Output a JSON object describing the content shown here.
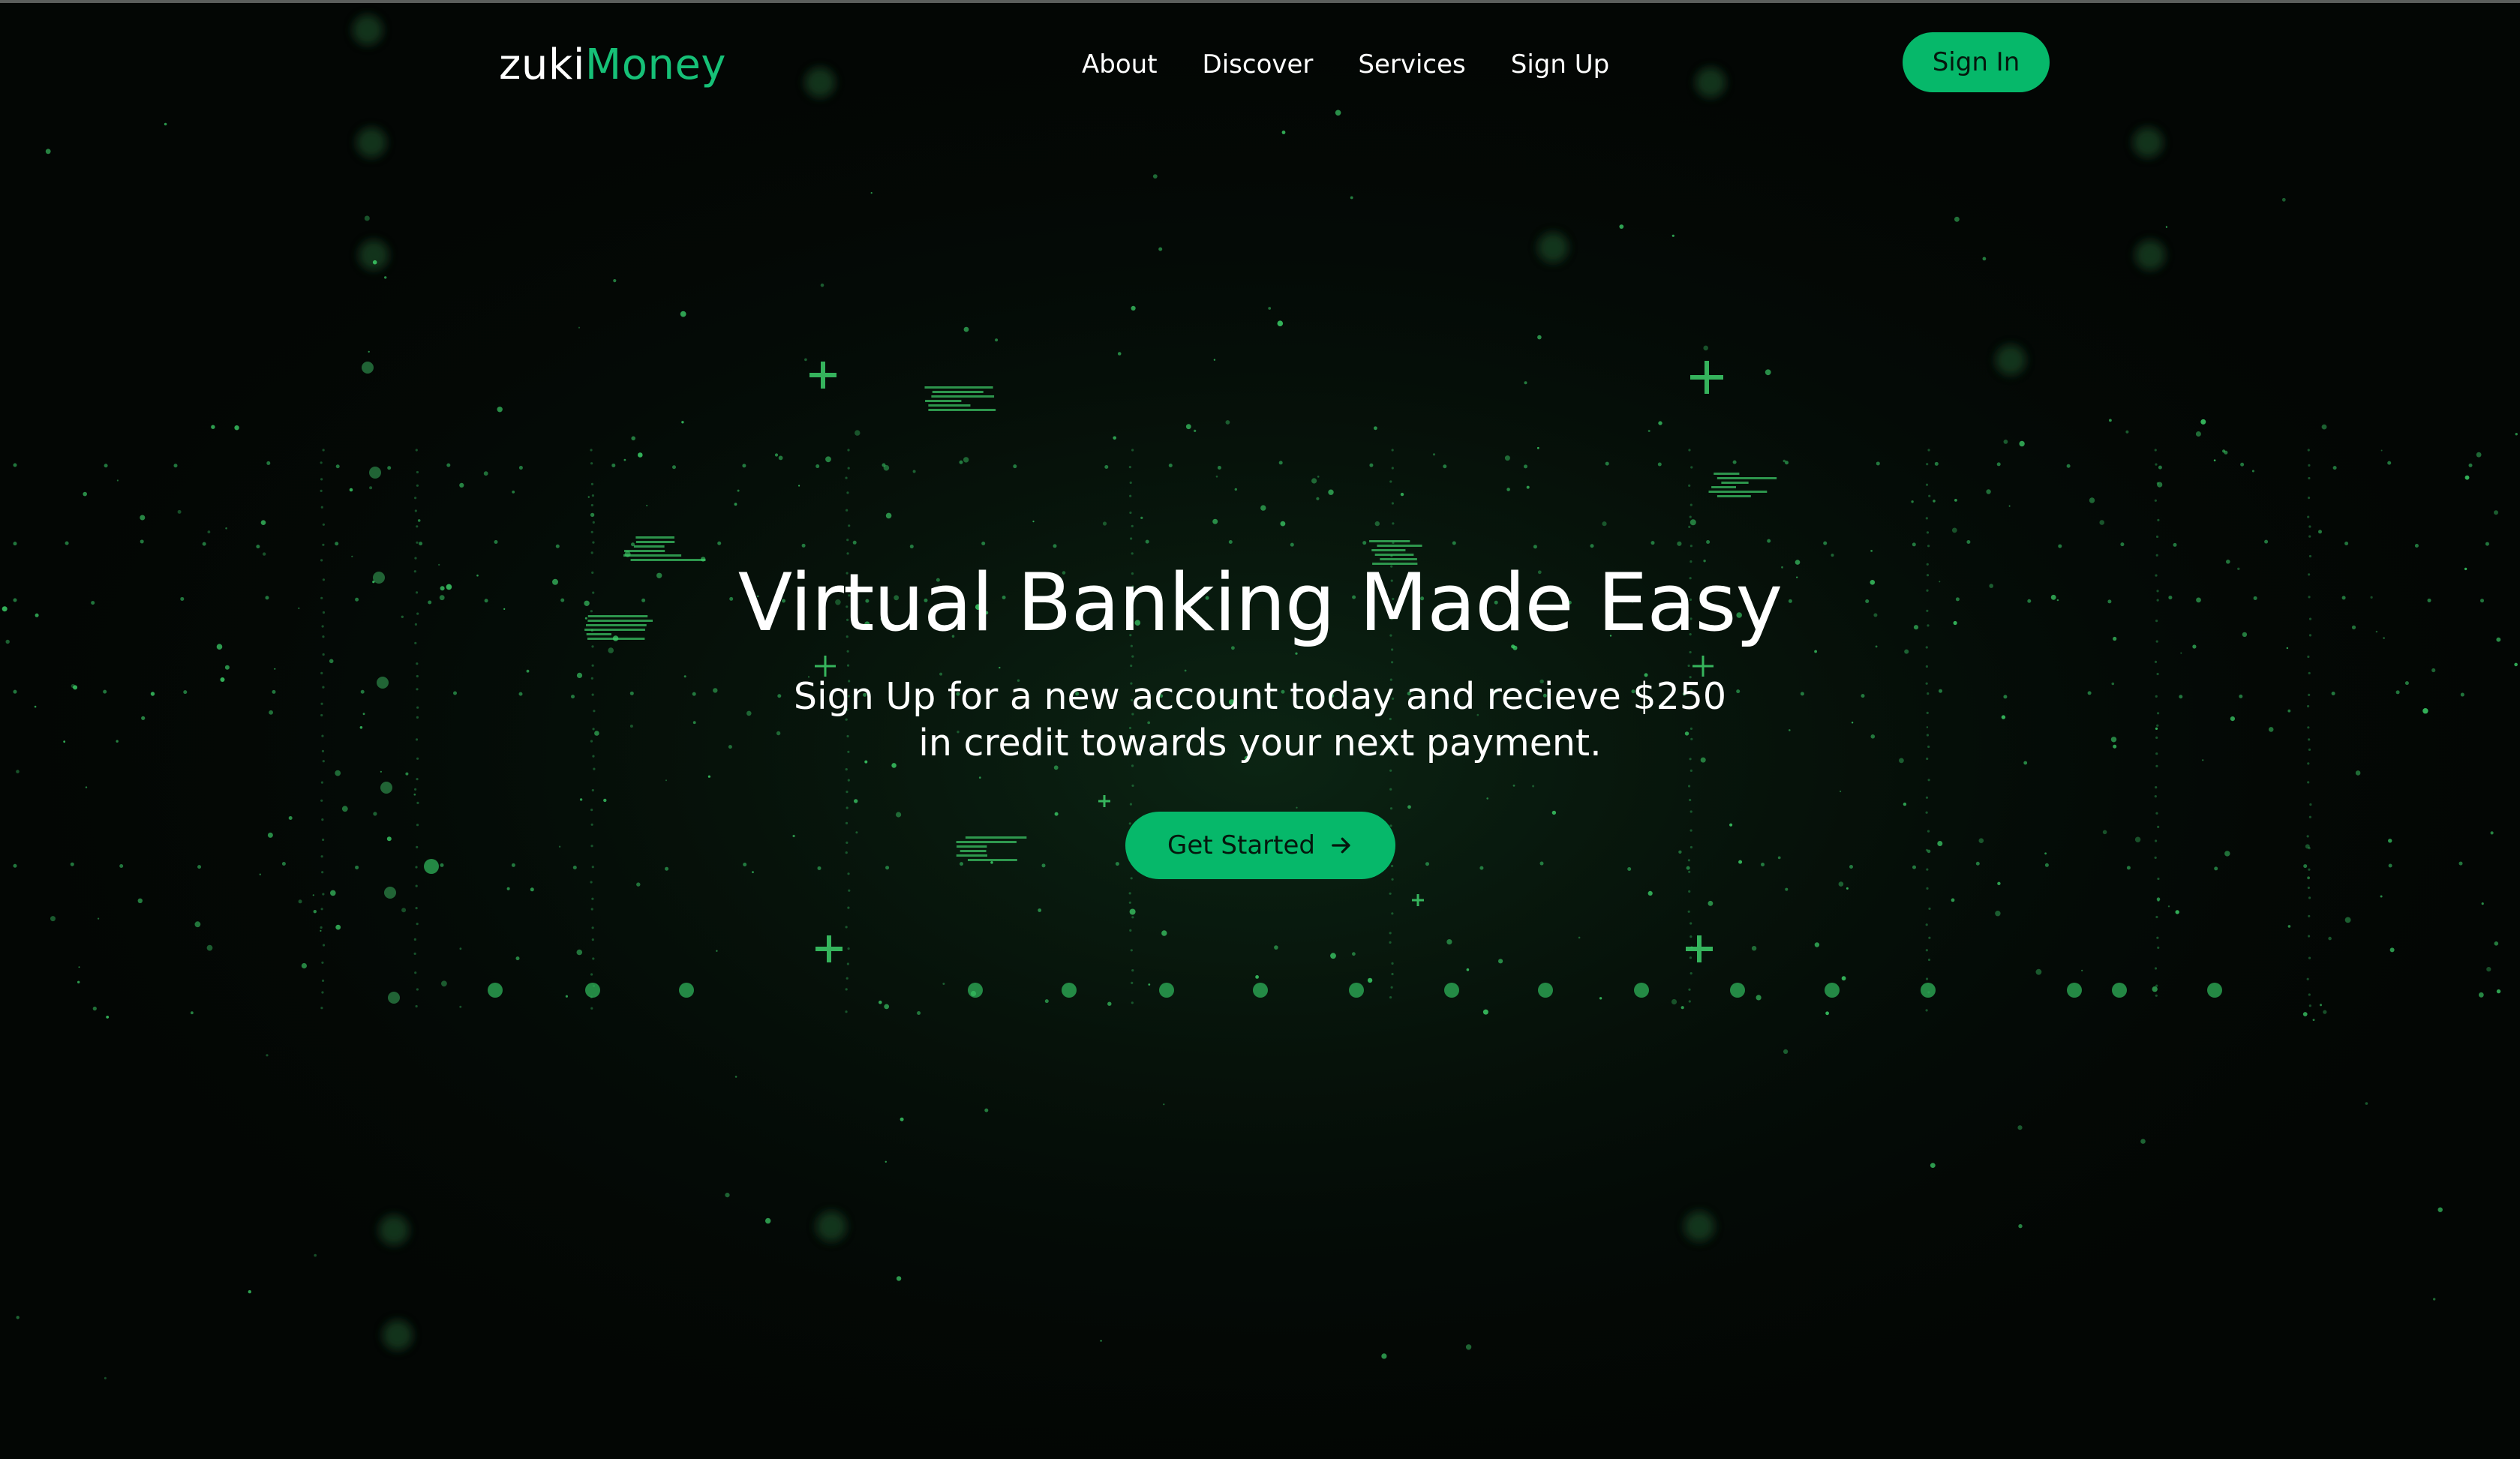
{
  "brand": {
    "logo_part1": "zuki",
    "logo_part2": "Money"
  },
  "nav": {
    "links": [
      "About",
      "Discover",
      "Services",
      "Sign Up"
    ],
    "signin_label": "Sign In"
  },
  "hero": {
    "title": "Virtual Banking Made Easy",
    "subtitle_line1": "Sign Up for a new account today and recieve $250",
    "subtitle_line2": "in credit towards your next payment.",
    "cta_label": "Get Started",
    "cta_icon": "arrow-right-icon"
  },
  "colors": {
    "background": "#030604",
    "accent": "#06b86a",
    "logo_accent": "#16c077",
    "text": "#ffffff"
  }
}
